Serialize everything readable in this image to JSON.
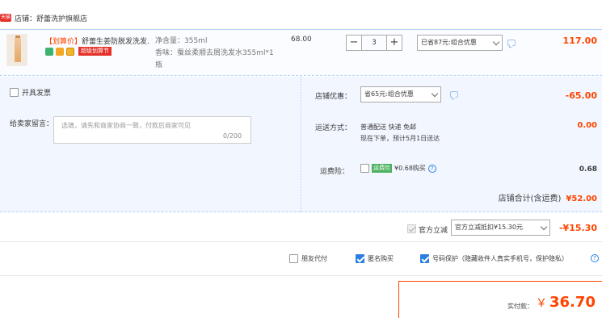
{
  "store": {
    "badge": "天猫",
    "name": "店铺：舒蕾洗护旗舰店"
  },
  "item": {
    "title_tag": "【划算价】",
    "title": "舒蕾生姜防脱发洗发...",
    "super_badge": "超级划算节",
    "spec_volume": "净含量：355ml",
    "spec_scent": "香味：蚕丝柔顺去屑洗发水355ml*1瓶",
    "unit_price": "68.00",
    "quantity": "3",
    "minus": "−",
    "plus": "+",
    "promo": "已省87元:组合优惠",
    "total": "117.00"
  },
  "invoice": {
    "label": "开具发票"
  },
  "message": {
    "label": "给卖家留言：",
    "placeholder": "选填，请先和商家协商一致，付款后商家可见",
    "count": "0/200"
  },
  "store_promo": {
    "label": "店铺优惠：",
    "value": "省65元:组合优惠",
    "amount": "-65.00"
  },
  "shipping": {
    "label": "运送方式：",
    "method": "普通配送 快递 免邮",
    "eta": "现在下单，预计5月1日送达",
    "amount": "0.00"
  },
  "insurance": {
    "label": "运费险：",
    "badge": "运费险",
    "text": "¥0.68购买",
    "help": "?",
    "amount": "0.68"
  },
  "store_total": {
    "label": "店铺合计(含运费)",
    "value": "¥52.00"
  },
  "official": {
    "label": "官方立减",
    "select": "官方立减抵扣¥15.30元",
    "amount": "-¥15.30"
  },
  "options": {
    "friend_pay": "朋友代付",
    "anonymous": "匿名购买",
    "privacy": "号码保护（隐藏收件人真实手机号，保护隐私）",
    "help": "?"
  },
  "payment": {
    "label": "实付款：",
    "currency": "￥",
    "amount": "36.70"
  },
  "colors": {
    "accent_red": "#ff4400",
    "blue_border": "#b2d1ff",
    "panel_bg": "#f2f7ff",
    "check_blue": "#2c7fe1"
  }
}
